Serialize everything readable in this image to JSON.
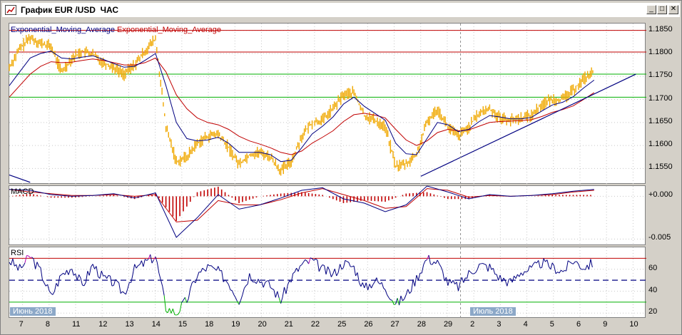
{
  "window": {
    "title": "График EUR /USD  ЧАС",
    "controls": {
      "minimize": "_",
      "maximize": "□",
      "close": "✕"
    }
  },
  "indicators": {
    "ema_blue_label": "Exponential_Moving_Average",
    "ema_red_label": "Exponential_Moving_Average",
    "macd_label": "MACD",
    "rsi_label": "RSI"
  },
  "colors": {
    "price": "#f0a800",
    "ema_fast": "#000080",
    "ema_slow": "#c00000",
    "resistance": "#c00000",
    "support": "#00b000",
    "trend": "#000080",
    "rsi": "#000080",
    "rsi_overbought": "#b000b0",
    "rsi_oversold": "#00b000",
    "macd_hist": "#c00000"
  },
  "chart_data": [
    {
      "type": "line",
      "name": "price-pane",
      "ylim": [
        1.1515,
        1.1865
      ],
      "y_ticks": [
        "1.1850",
        "1.1800",
        "1.1750",
        "1.1700",
        "1.1650",
        "1.1600",
        "1.1550"
      ],
      "y_tick_values": [
        1.185,
        1.18,
        1.175,
        1.17,
        1.165,
        1.16,
        1.155
      ],
      "resistance_levels": [
        1.185,
        1.1803
      ],
      "support_levels": [
        1.1755,
        1.1705
      ],
      "x": [
        0,
        0.5,
        1,
        1.5,
        2,
        2.5,
        3,
        3.5,
        4,
        4.5,
        5,
        5.5,
        6,
        6.5,
        7,
        7.5,
        8,
        8.5,
        9,
        9.5,
        10,
        10.5,
        11,
        11.5,
        12,
        12.5,
        13,
        13.5,
        14,
        14.5,
        15,
        15.5,
        16,
        16.5,
        17,
        17.5,
        18,
        18.5,
        19,
        19.5,
        20,
        20.5,
        21,
        21.5,
        22,
        22.5,
        23,
        23.5,
        24,
        24.5,
        25,
        25.5,
        26,
        26.5,
        27,
        27.5,
        28
      ],
      "price": [
        1.177,
        1.181,
        1.1835,
        1.1822,
        1.1815,
        1.176,
        1.179,
        1.1805,
        1.1798,
        1.178,
        1.177,
        1.1755,
        1.1775,
        1.1805,
        1.1832,
        1.164,
        1.1565,
        1.1575,
        1.1605,
        1.162,
        1.1625,
        1.1595,
        1.156,
        1.158,
        1.1585,
        1.1575,
        1.1545,
        1.1565,
        1.162,
        1.165,
        1.1655,
        1.168,
        1.171,
        1.1715,
        1.1665,
        1.1655,
        1.164,
        1.1555,
        1.156,
        1.158,
        1.165,
        1.168,
        1.164,
        1.162,
        1.164,
        1.167,
        1.168,
        1.166,
        1.1655,
        1.166,
        1.1665,
        1.169,
        1.17,
        1.17,
        1.172,
        1.1745,
        1.176
      ],
      "ema_fast": [
        1.173,
        1.176,
        1.179,
        1.18,
        1.1805,
        1.179,
        1.1788,
        1.1792,
        1.1795,
        1.1787,
        1.1778,
        1.177,
        1.1772,
        1.1785,
        1.18,
        1.173,
        1.165,
        1.1615,
        1.161,
        1.1612,
        1.1618,
        1.1605,
        1.1585,
        1.1585,
        1.1585,
        1.158,
        1.1565,
        1.1568,
        1.1595,
        1.1625,
        1.1642,
        1.1662,
        1.169,
        1.1705,
        1.1685,
        1.167,
        1.1655,
        1.1605,
        1.1582,
        1.158,
        1.1615,
        1.165,
        1.1645,
        1.163,
        1.1635,
        1.1652,
        1.1665,
        1.1662,
        1.1658,
        1.1658,
        1.1661,
        1.1675,
        1.1688,
        1.1694,
        1.1706,
        1.1725,
        1.1742
      ],
      "ema_slow": [
        1.1705,
        1.173,
        1.1755,
        1.1772,
        1.1782,
        1.178,
        1.1781,
        1.1785,
        1.1788,
        1.1785,
        1.178,
        1.1775,
        1.1775,
        1.178,
        1.179,
        1.176,
        1.171,
        1.168,
        1.166,
        1.165,
        1.1645,
        1.1635,
        1.162,
        1.161,
        1.1603,
        1.1595,
        1.1585,
        1.158,
        1.1588,
        1.1605,
        1.1618,
        1.1632,
        1.1652,
        1.1667,
        1.167,
        1.1666,
        1.166,
        1.1635,
        1.1612,
        1.16,
        1.161,
        1.1628,
        1.1635,
        1.1632,
        1.1634,
        1.1642,
        1.165,
        1.1652,
        1.1653,
        1.1654,
        1.1656,
        1.1663,
        1.1672,
        1.1678,
        1.1686,
        1.17,
        1.1715
      ],
      "trend_line": {
        "from": [
          19.7,
          1.1533
        ],
        "to": [
          30.0,
          1.1755
        ]
      },
      "trend_line_2": {
        "from": [
          0,
          1.1536
        ],
        "to": [
          1.0,
          1.152
        ]
      }
    },
    {
      "type": "line",
      "name": "macd-pane",
      "ylim": [
        -0.0058,
        0.0012
      ],
      "y_ticks": [
        "+0.000",
        "-0.005"
      ],
      "y_tick_values": [
        0,
        -0.005
      ],
      "x": [
        0,
        1,
        2,
        3,
        4,
        5,
        6,
        7,
        8,
        9,
        10,
        11,
        12,
        13,
        14,
        15,
        16,
        17,
        18,
        19,
        20,
        21,
        22,
        23,
        24,
        25,
        26,
        27,
        28
      ],
      "macd": [
        0.0008,
        0.0007,
        0.0002,
        0.0,
        0.0001,
        0.0003,
        -0.0002,
        0.0004,
        -0.0048,
        -0.0025,
        0.0002,
        -0.0015,
        -0.001,
        -0.0002,
        0.0007,
        0.001,
        -0.0003,
        -0.0008,
        -0.0018,
        -0.001,
        0.0012,
        0.0005,
        -0.0003,
        0.0002,
        0.0,
        0.0001,
        0.0003,
        0.0006,
        0.0008
      ],
      "signal": [
        0.0008,
        0.0005,
        0.0003,
        0.0001,
        0.0001,
        0.0002,
        0.0,
        0.0002,
        -0.003,
        -0.0028,
        -0.0005,
        -0.001,
        -0.001,
        -0.0004,
        0.0004,
        0.0009,
        0.0002,
        -0.0005,
        -0.0014,
        -0.0012,
        0.0009,
        0.0007,
        -0.0001,
        0.0001,
        0.0,
        0.0001,
        0.0002,
        0.0005,
        0.0007
      ]
    },
    {
      "type": "line",
      "name": "rsi-pane",
      "ylim": [
        15,
        80
      ],
      "y_ticks": [
        "60",
        "40",
        "20"
      ],
      "y_tick_values": [
        60,
        40,
        20
      ],
      "overbought": 70,
      "midline": 50,
      "oversold": 30,
      "x": [
        0,
        0.5,
        1,
        1.5,
        2,
        2.5,
        3,
        3.5,
        4,
        4.5,
        5,
        5.5,
        6,
        6.5,
        7,
        7.5,
        8,
        8.5,
        9,
        9.5,
        10,
        10.5,
        11,
        11.5,
        12,
        12.5,
        13,
        13.5,
        14,
        14.5,
        15,
        15.5,
        16,
        16.5,
        17,
        17.5,
        18,
        18.5,
        19,
        19.5,
        20,
        20.5,
        21,
        21.5,
        22,
        22.5,
        23,
        23.5,
        24,
        24.5,
        25,
        25.5,
        26,
        26.5,
        27,
        27.5,
        28
      ],
      "rsi": [
        68,
        60,
        72,
        58,
        35,
        55,
        62,
        45,
        64,
        52,
        48,
        38,
        60,
        66,
        72,
        25,
        20,
        32,
        55,
        62,
        58,
        48,
        32,
        55,
        50,
        45,
        32,
        52,
        64,
        68,
        60,
        55,
        66,
        62,
        42,
        50,
        44,
        28,
        36,
        52,
        70,
        66,
        48,
        44,
        56,
        64,
        62,
        52,
        48,
        58,
        60,
        66,
        62,
        58,
        68,
        62,
        66
      ]
    }
  ],
  "x_axis": {
    "labels": [
      "7",
      "8",
      "11",
      "12",
      "13",
      "14",
      "15",
      "18",
      "19",
      "20",
      "21",
      "22",
      "25",
      "26",
      "27",
      "28",
      "29",
      "2",
      "3",
      "4",
      "5",
      "6",
      "9",
      "10"
    ],
    "month_tags": [
      "Июнь 2018",
      "Июль 2018"
    ]
  }
}
